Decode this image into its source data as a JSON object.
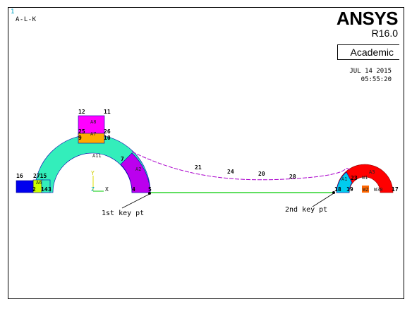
{
  "window_number": "1",
  "plot_label": "A-L-K",
  "brand": {
    "name": "ANSYS",
    "version": "R16.0",
    "edition": "Academic"
  },
  "stamp": {
    "date": "JUL 14 2015",
    "time": "05:55:20"
  },
  "keypoint_labels": [
    "12",
    "11",
    "25",
    "26",
    "9",
    "10",
    "16",
    "2715",
    "2",
    "14",
    "3",
    "7",
    "4",
    "5",
    "21",
    "24",
    "20",
    "28",
    "18",
    "19",
    "17",
    "23"
  ],
  "area_labels": [
    "A8",
    "A7",
    "A11",
    "A2",
    "A3",
    "A1",
    "A6",
    "W1",
    "WZ",
    "W30"
  ],
  "axis_labels": [
    "Y",
    "Z",
    "X"
  ],
  "annotations": [
    "1st key pt",
    "2nd key pt"
  ],
  "colors": {
    "teal": "#33eebb",
    "magenta": "#ff00ff",
    "orange": "#ffaa00",
    "blue": "#0000ee",
    "yellow": "#ccff00",
    "purple": "#bb00ee",
    "red": "#ff0000",
    "cyan": "#00ccee",
    "line_green": "#00cc00",
    "line_purple": "#aa00cc"
  }
}
